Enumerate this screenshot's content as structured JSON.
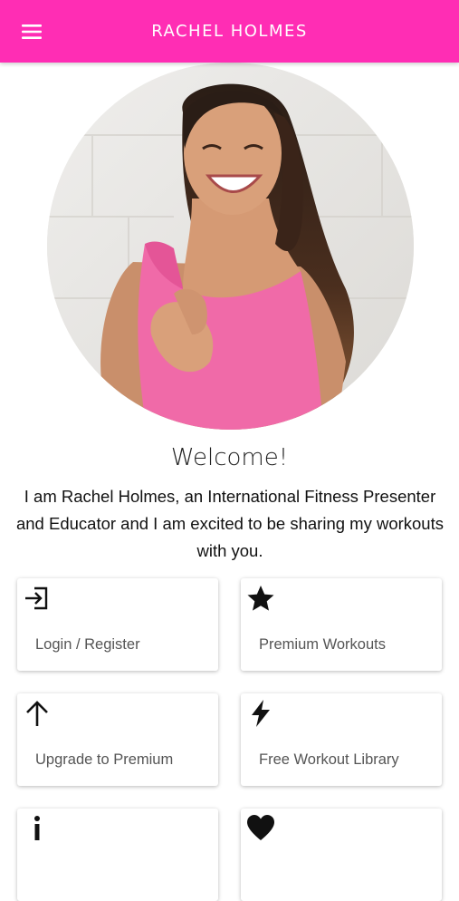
{
  "app_bar": {
    "title": "RACHEL HOLMES",
    "menu_icon": "hamburger-menu-icon",
    "color": "#ff2db4"
  },
  "hero": {
    "image": "Portrait photo of Rachel Holmes laughing in a pink tank top"
  },
  "welcome": {
    "heading": "Welcome!",
    "text": "I am Rachel Holmes, an International Fitness Presenter and Educator and I am excited to be sharing my workouts with you."
  },
  "cards": [
    {
      "label": "Login / Register",
      "icon": "login-icon"
    },
    {
      "label": "Premium Workouts",
      "icon": "star-icon"
    },
    {
      "label": "Upgrade to Premium",
      "icon": "arrow-up-icon"
    },
    {
      "label": "Free Workout Library",
      "icon": "lightning-bolt-icon"
    },
    {
      "label": "",
      "icon": "info-icon"
    },
    {
      "label": "",
      "icon": "heart-icon"
    }
  ]
}
